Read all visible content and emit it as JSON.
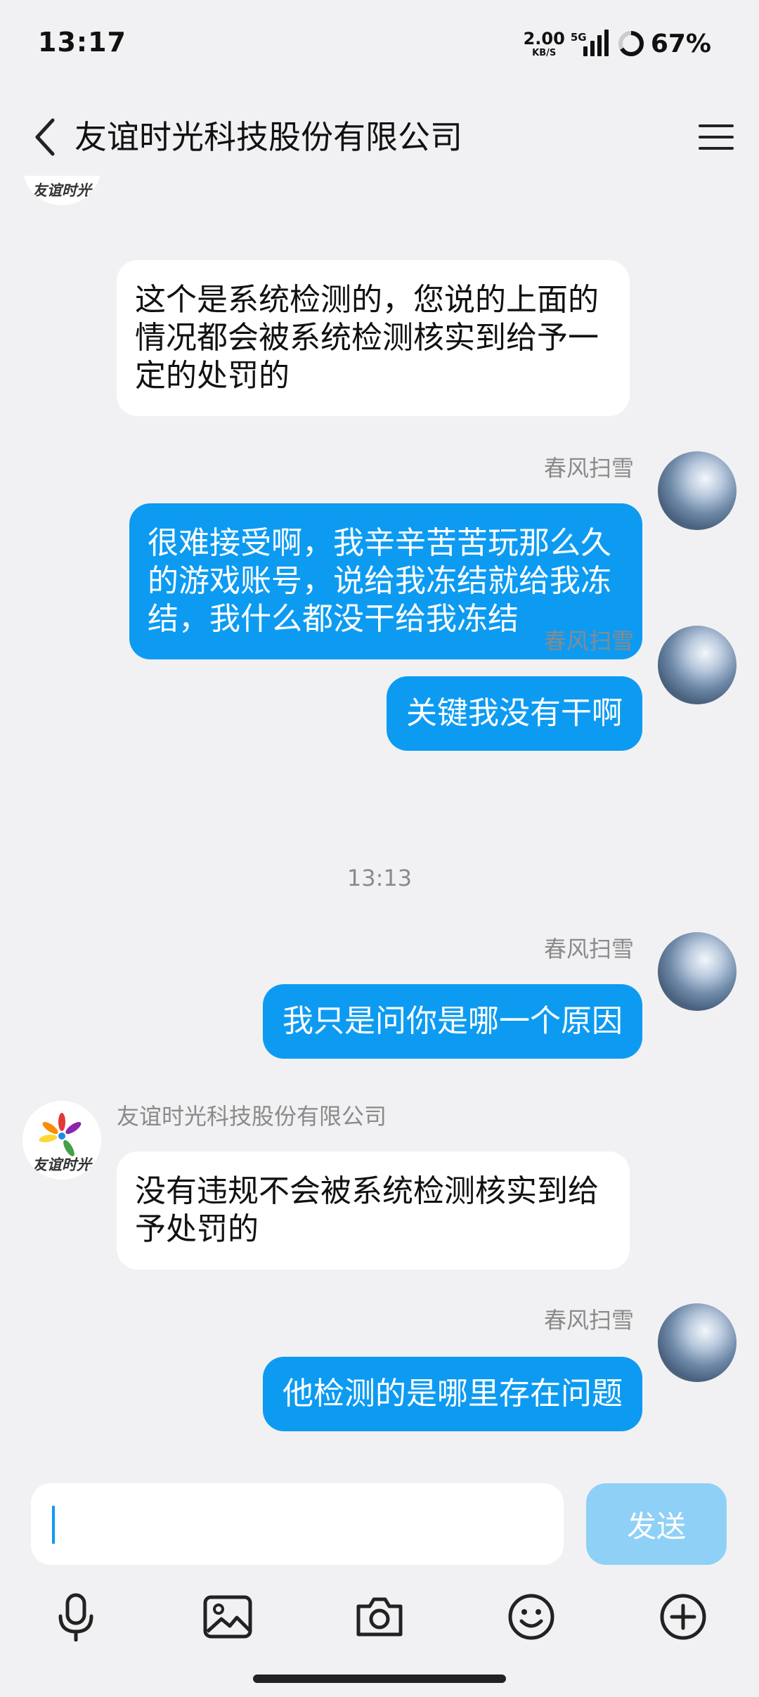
{
  "status_bar": {
    "time": "13:17",
    "net_speed_value": "2.00",
    "net_speed_unit": "KB/S",
    "network_type": "5G",
    "battery": "67%"
  },
  "header": {
    "title": "友谊时光科技股份有限公司"
  },
  "contacts": {
    "company_name": "友谊时光科技股份有限公司",
    "company_logo_text": "友谊时光",
    "user_name": "春风扫雪"
  },
  "messages": [
    {
      "direction": "in",
      "text": "这个是系统检测的，您说的上面的情况都会被系统检测核实到给予一定的处罚的"
    },
    {
      "direction": "out",
      "sender": "春风扫雪",
      "text": "很难接受啊，我辛辛苦苦玩那么久的游戏账号，说给我冻结就给我冻结，我什么都没干给我冻结"
    },
    {
      "direction": "out",
      "sender": "春风扫雪",
      "text": "关键我没有干啊"
    },
    {
      "direction": "out",
      "sender": "春风扫雪",
      "text": "我只是问你是哪一个原因"
    },
    {
      "direction": "in",
      "sender": "友谊时光科技股份有限公司",
      "text": "没有违规不会被系统检测核实到给予处罚的"
    },
    {
      "direction": "out",
      "sender": "春风扫雪",
      "text": "他检测的是哪里存在问题"
    }
  ],
  "timestamps": [
    "13:13"
  ],
  "composer": {
    "input_value": "",
    "send_label": "发送"
  },
  "colors": {
    "outgoing_bubble": "#0d9bf2",
    "send_button": "#8fd0f7",
    "background": "#f1f1f3"
  }
}
